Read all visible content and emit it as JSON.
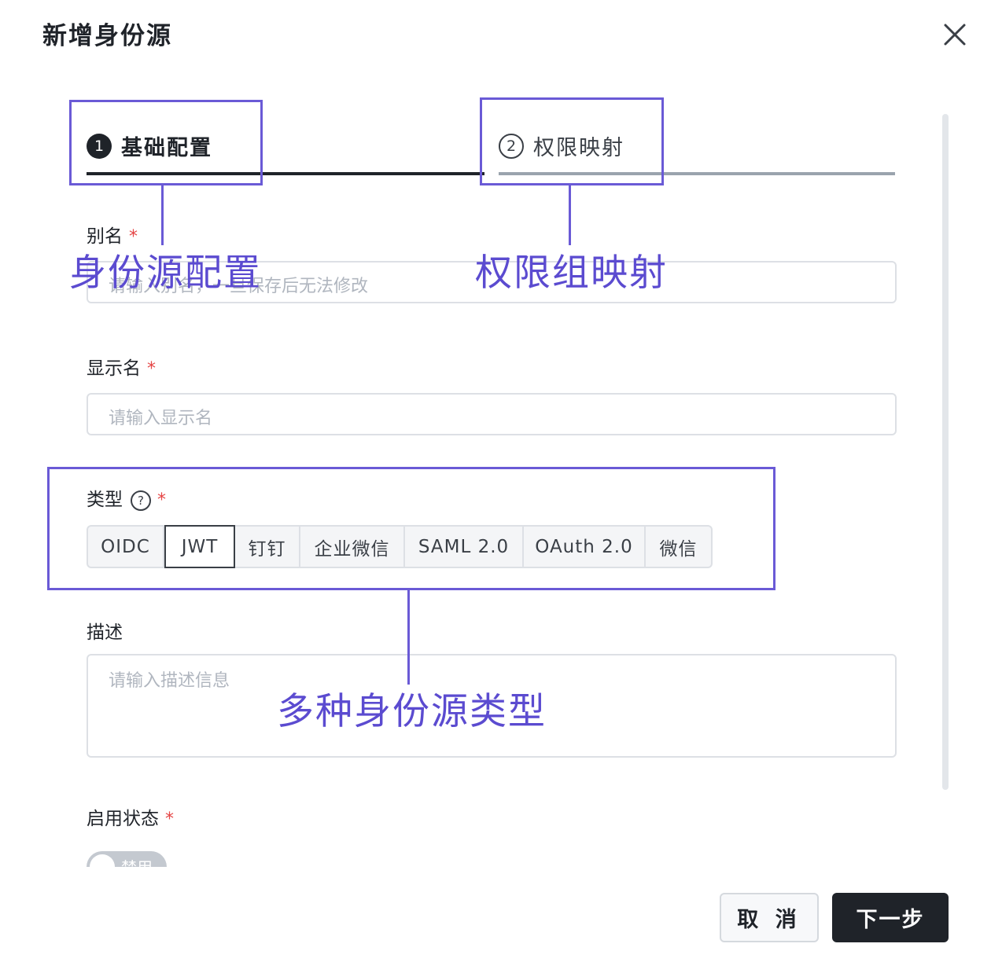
{
  "dialog": {
    "title": "新增身份源"
  },
  "steps": [
    {
      "number": "1",
      "label": "基础配置",
      "active": true
    },
    {
      "number": "2",
      "label": "权限映射",
      "active": false
    }
  ],
  "form": {
    "alias": {
      "label": "别名",
      "required_mark": "*",
      "placeholder": "请输入别名，一旦保存后无法修改"
    },
    "display_name": {
      "label": "显示名",
      "required_mark": "*",
      "placeholder": "请输入显示名"
    },
    "type": {
      "label": "类型",
      "help_icon": "question-circle-icon",
      "required_mark": "*",
      "options": [
        "OIDC",
        "JWT",
        "钉钉",
        "企业微信",
        "SAML 2.0",
        "OAuth 2.0",
        "微信"
      ],
      "selected": "JWT"
    },
    "description": {
      "label": "描述",
      "placeholder": "请输入描述信息"
    },
    "status": {
      "label": "启用状态",
      "required_mark": "*",
      "toggle_text": "禁用",
      "enabled": false
    }
  },
  "footer": {
    "cancel_label": "取 消",
    "next_label": "下一步"
  },
  "annotations": {
    "identity_source_config": "身份源配置",
    "permission_group_mapping": "权限组映射",
    "multiple_source_types": "多种身份源类型",
    "color": "#6a5ad6"
  },
  "colors": {
    "primary_dark": "#1f2329",
    "required": "#e54545",
    "annotation": "#6a5ad6"
  }
}
